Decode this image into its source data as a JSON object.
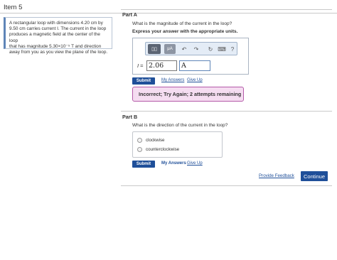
{
  "item": {
    "title": "Item 5"
  },
  "problem": {
    "l1": "A rectangular loop with dimensions 4.20 cm by",
    "l2": "9.50 cm carries current I. The current in the loop",
    "l3": "produces a magnetic field at the center of the loop",
    "l4": "that has magnitude 5.30×10⁻⁵ T and direction",
    "l5": "away from you as you view the plane of the loop."
  },
  "partA": {
    "title": "Part A",
    "question": "What is the magnitude of the current in the loop?",
    "instruction": "Express your answer with the appropriate units.",
    "toolbar": {
      "template_glyph": "▯▯",
      "unit_glyph": "μA",
      "undo_glyph": "↶",
      "redo_glyph": "↷",
      "reset_glyph": "↻",
      "keyboard_glyph": "⌨",
      "help_glyph": "?"
    },
    "equation_var": "I",
    "equation_sign": " =",
    "value": "2.06",
    "unit": "A",
    "submit": "Submit",
    "my_answers": "My Answers",
    "give_up": "Give Up",
    "feedback": "Incorrect; Try Again; 2 attempts remaining"
  },
  "partB": {
    "title": "Part B",
    "question": "What is the direction of the current in the loop?",
    "options": [
      "clockwise",
      "counterclockwise"
    ],
    "submit": "Submit",
    "my_answers": "My Answers",
    "give_up": "Give Up"
  },
  "footer": {
    "provide_feedback": "Provide Feedback",
    "continue": "Continue"
  },
  "colors": {
    "accent": "#1f4f99",
    "incorrect_bg": "#f5ddf1",
    "incorrect_border": "#b45aa8"
  }
}
